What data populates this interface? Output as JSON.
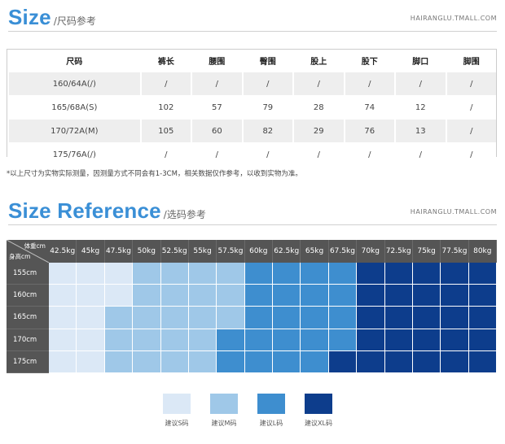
{
  "section1": {
    "title": "Size",
    "subtitle": "/尺码参考",
    "url": "HAIRANGLU.TMALL.COM"
  },
  "size_table": {
    "headers": [
      "尺码",
      "裤长",
      "腰围",
      "臀围",
      "股上",
      "股下",
      "脚口",
      "脚围"
    ],
    "rows": [
      [
        "160/64A(/)",
        "/",
        "/",
        "/",
        "/",
        "/",
        "/",
        "/"
      ],
      [
        "165/68A(S)",
        "102",
        "57",
        "79",
        "28",
        "74",
        "12",
        "/"
      ],
      [
        "170/72A(M)",
        "105",
        "60",
        "82",
        "29",
        "76",
        "13",
        "/"
      ],
      [
        "175/76A(/)",
        "/",
        "/",
        "/",
        "/",
        "/",
        "/",
        "/"
      ]
    ]
  },
  "note": "*以上尺寸为实物实际测量，因测量方式不同会有1-3CM，相关数据仅作参考，以收到实物为准。",
  "section2": {
    "title": "Size Reference",
    "subtitle": "/选码参考",
    "url": "HAIRANGLU.TMALL.COM"
  },
  "reference": {
    "corner_weight": "体重cm",
    "corner_height": "身高cm",
    "weights": [
      "42.5kg",
      "45kg",
      "47.5kg",
      "50kg",
      "52.5kg",
      "55kg",
      "57.5kg",
      "60kg",
      "62.5kg",
      "65kg",
      "67.5kg",
      "70kg",
      "72.5kg",
      "75kg",
      "77.5kg",
      "80kg"
    ],
    "heights": [
      "155cm",
      "160cm",
      "165cm",
      "170cm",
      "175cm"
    ],
    "grid": [
      [
        "S",
        "S",
        "S",
        "M",
        "M",
        "M",
        "M",
        "L",
        "L",
        "L",
        "L",
        "XL",
        "XL",
        "XL",
        "XL",
        "XL"
      ],
      [
        "S",
        "S",
        "S",
        "M",
        "M",
        "M",
        "M",
        "L",
        "L",
        "L",
        "L",
        "XL",
        "XL",
        "XL",
        "XL",
        "XL"
      ],
      [
        "S",
        "S",
        "M",
        "M",
        "M",
        "M",
        "M",
        "L",
        "L",
        "L",
        "L",
        "XL",
        "XL",
        "XL",
        "XL",
        "XL"
      ],
      [
        "S",
        "S",
        "M",
        "M",
        "M",
        "M",
        "L",
        "L",
        "L",
        "L",
        "L",
        "XL",
        "XL",
        "XL",
        "XL",
        "XL"
      ],
      [
        "S",
        "S",
        "M",
        "M",
        "M",
        "M",
        "L",
        "L",
        "L",
        "L",
        "XL",
        "XL",
        "XL",
        "XL",
        "XL",
        "XL"
      ]
    ],
    "colors": {
      "S": "#dbe8f6",
      "M": "#9fc8e8",
      "L": "#3e8ecf",
      "XL": "#0d3d8c"
    }
  },
  "legend": [
    {
      "key": "S",
      "label": "建议S码"
    },
    {
      "key": "M",
      "label": "建议M码"
    },
    {
      "key": "L",
      "label": "建议L码"
    },
    {
      "key": "XL",
      "label": "建议XL码"
    }
  ]
}
